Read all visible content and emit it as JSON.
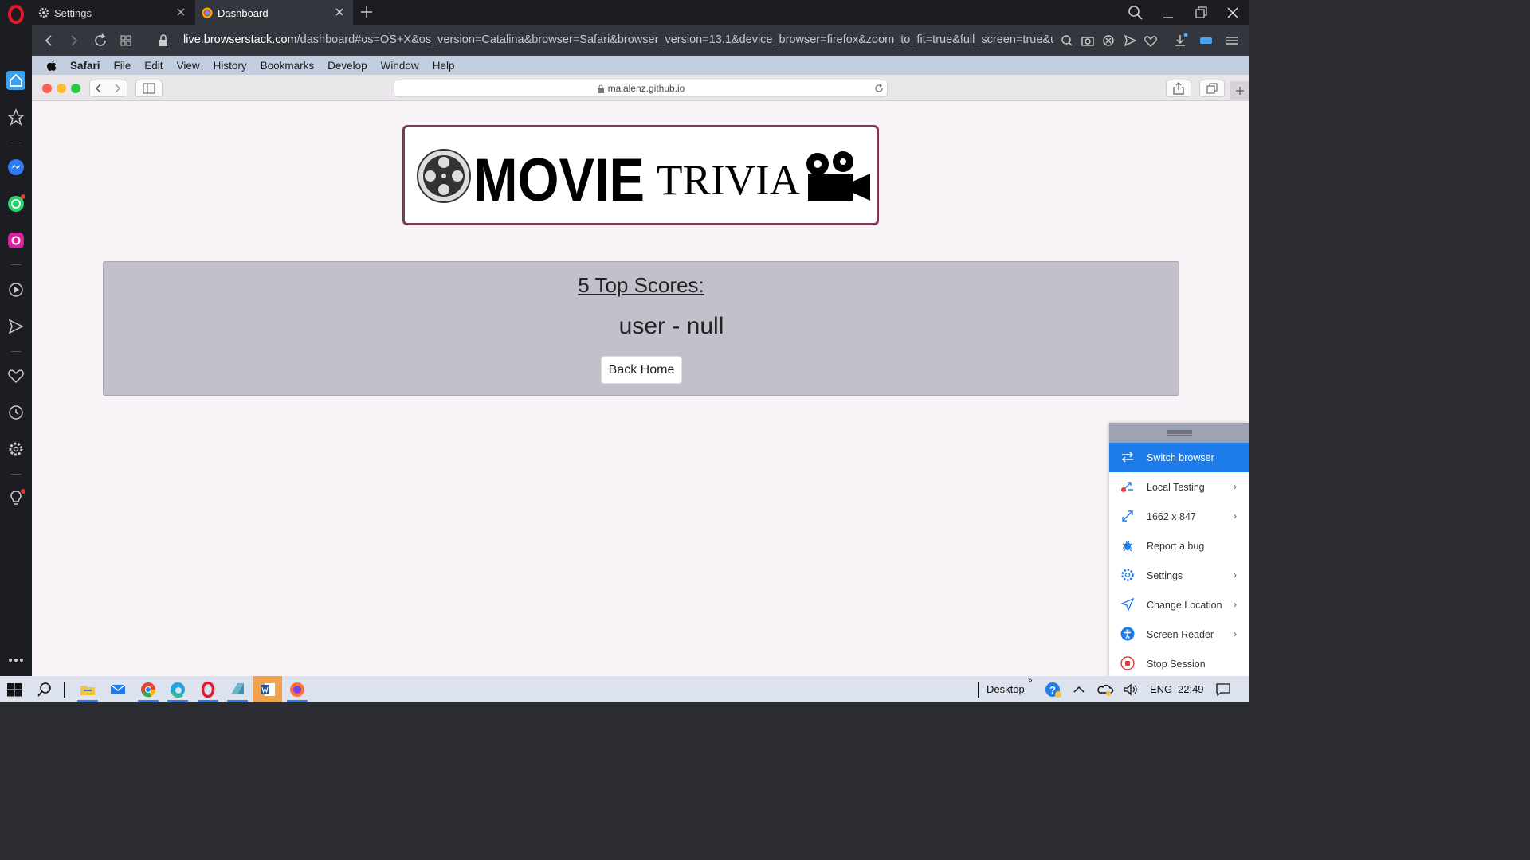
{
  "browser": {
    "tabs": [
      {
        "label": "Settings",
        "icon": "gear-icon"
      },
      {
        "label": "Dashboard",
        "icon": "browserstack-icon"
      }
    ],
    "url_domain": "live.browserstack.com",
    "url_rest": "/dashboard#os=OS+X&os_version=Catalina&browser=Safari&browser_version=13.1&device_browser=firefox&zoom_to_fit=true&full_screen=true&ur"
  },
  "mac_menu": [
    "Safari",
    "File",
    "Edit",
    "View",
    "History",
    "Bookmarks",
    "Develop",
    "Window",
    "Help"
  ],
  "safari": {
    "address": "maialenz.github.io"
  },
  "page": {
    "logo_text": "MOVIE TRIVIA",
    "scores_title": "5 Top Scores:",
    "score_entry": "user - null",
    "back_button": "Back Home"
  },
  "bs_panel": {
    "items": [
      {
        "label": "Switch browser",
        "icon": "switch-icon",
        "chevron": false
      },
      {
        "label": "Local Testing",
        "icon": "local-testing-icon",
        "chevron": true
      },
      {
        "label": "1662 x 847",
        "icon": "resize-icon",
        "chevron": true
      },
      {
        "label": "Report a bug",
        "icon": "bug-icon",
        "chevron": false
      },
      {
        "label": "Settings",
        "icon": "gear-icon",
        "chevron": true
      },
      {
        "label": "Change Location",
        "icon": "location-icon",
        "chevron": true
      },
      {
        "label": "Screen Reader",
        "icon": "accessibility-icon",
        "chevron": true
      },
      {
        "label": "Stop Session",
        "icon": "stop-icon",
        "chevron": false
      }
    ]
  },
  "taskbar": {
    "desktop": "Desktop",
    "lang": "ENG",
    "time": "22:49"
  },
  "colors": {
    "accent": "#1e7bea",
    "logo_border": "#7b3a56",
    "panel_bg": "#c3bfcb"
  }
}
